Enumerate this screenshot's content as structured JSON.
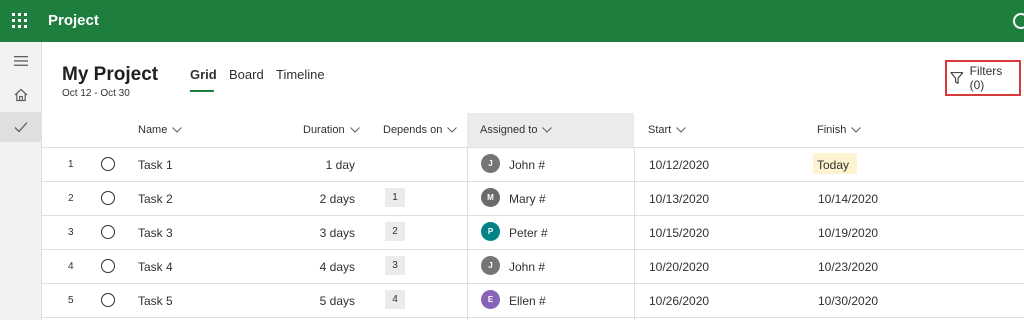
{
  "app": {
    "title": "Project"
  },
  "project": {
    "title": "My Project",
    "dates": "Oct 12 - Oct 30"
  },
  "tabs": [
    {
      "label": "Grid",
      "active": true
    },
    {
      "label": "Board",
      "active": false
    },
    {
      "label": "Timeline",
      "active": false
    }
  ],
  "filters": {
    "label": "Filters (0)"
  },
  "columns": {
    "name": "Name",
    "duration": "Duration",
    "depends_on": "Depends on",
    "assigned_to": "Assigned to",
    "start": "Start",
    "finish": "Finish"
  },
  "rows": [
    {
      "num": "1",
      "name": "Task 1",
      "duration": "1 day",
      "depends_on": "",
      "avatar": "J",
      "avatar_color": "#757575",
      "assignee": "John #",
      "start": "10/12/2020",
      "finish": "Today"
    },
    {
      "num": "2",
      "name": "Task 2",
      "duration": "2 days",
      "depends_on": "1",
      "avatar": "M",
      "avatar_color": "#6b6b6b",
      "assignee": "Mary #",
      "start": "10/13/2020",
      "finish": "10/14/2020"
    },
    {
      "num": "3",
      "name": "Task 3",
      "duration": "3 days",
      "depends_on": "2",
      "avatar": "P",
      "avatar_color": "#038387",
      "assignee": "Peter #",
      "start": "10/15/2020",
      "finish": "10/19/2020"
    },
    {
      "num": "4",
      "name": "Task 4",
      "duration": "4 days",
      "depends_on": "3",
      "avatar": "J",
      "avatar_color": "#757575",
      "assignee": "John #",
      "start": "10/20/2020",
      "finish": "10/23/2020"
    },
    {
      "num": "5",
      "name": "Task 5",
      "duration": "5 days",
      "depends_on": "4",
      "avatar": "E",
      "avatar_color": "#8764b8",
      "assignee": "Ellen #",
      "start": "10/26/2020",
      "finish": "10/30/2020"
    }
  ],
  "colors": {
    "brand": "#1e7e3e",
    "highlight_border": "#d9383a",
    "today_chip": "#fdf3d0"
  },
  "icons": {
    "waffle": "app-launcher-icon",
    "smiley": "feedback-smiley-icon",
    "hamburger": "hamburger-menu-icon",
    "home": "home-icon",
    "check": "checkmark-icon",
    "filter": "filter-funnel-icon",
    "chevron": "chevron-down-icon"
  }
}
